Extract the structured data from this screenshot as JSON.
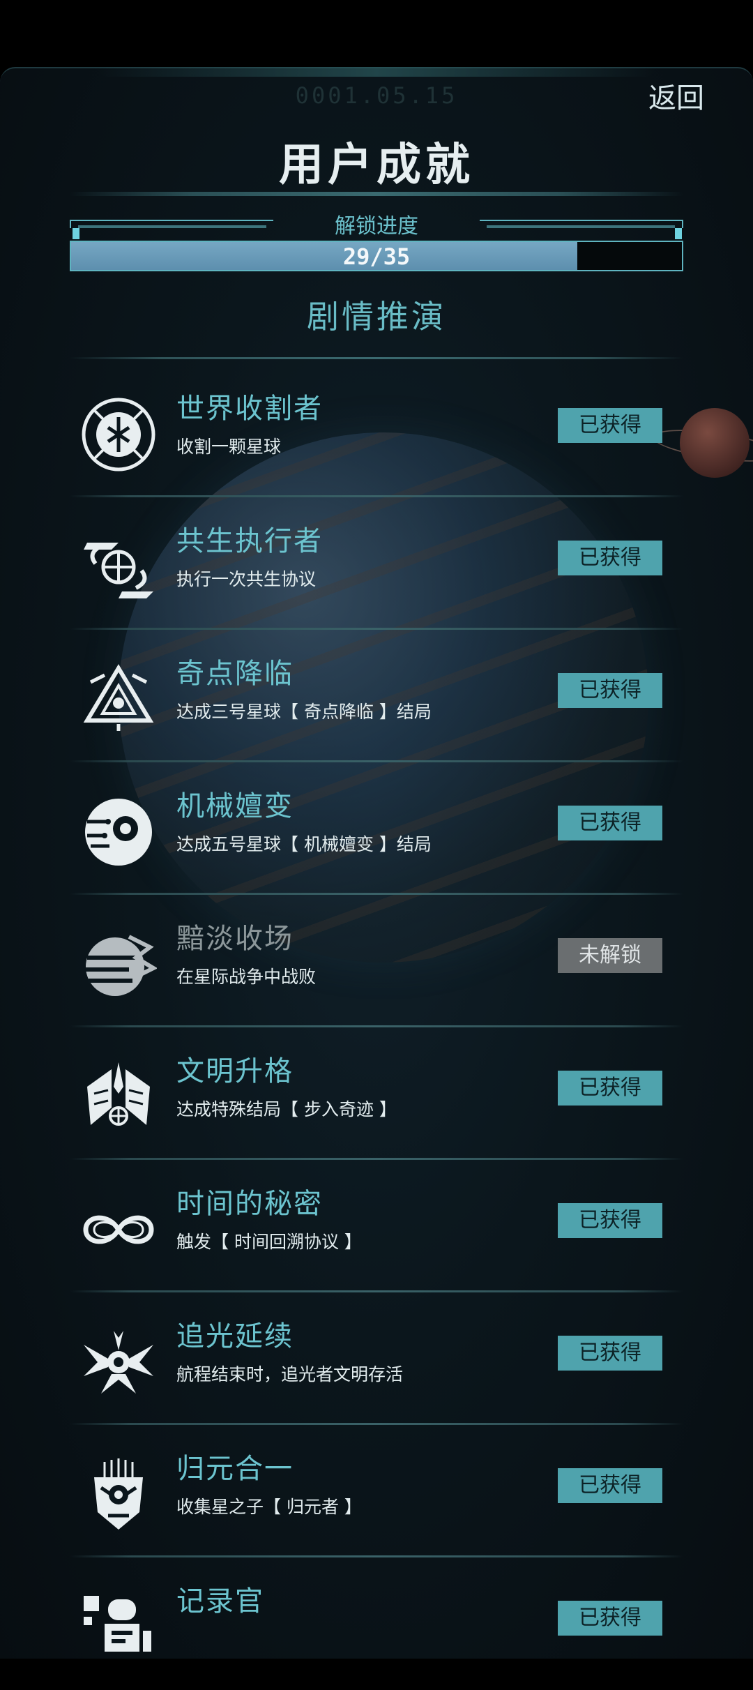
{
  "header": {
    "date": "0001.05.15",
    "back_label": "返回",
    "title": "用户成就"
  },
  "progress": {
    "label": "解锁进度",
    "text": "29/35",
    "unlocked": 29,
    "total": 35
  },
  "section_title": "剧情推演",
  "colors": {
    "accent": "#6cc4cf",
    "badge_obtained": "#4fa3ad",
    "badge_locked": "#6a6e70"
  },
  "achievements": [
    {
      "icon": "world-reaper-icon",
      "name": "世界收割者",
      "desc": "收割一颗星球",
      "status": "已获得",
      "unlocked": true
    },
    {
      "icon": "symbiosis-globe-hands-icon",
      "name": "共生执行者",
      "desc": "执行一次共生协议",
      "status": "已获得",
      "unlocked": true
    },
    {
      "icon": "singularity-triangle-icon",
      "name": "奇点降临",
      "desc": "达成三号星球【 奇点降临 】结局",
      "status": "已获得",
      "unlocked": true
    },
    {
      "icon": "mechanical-eye-icon",
      "name": "机械嬗变",
      "desc": "达成五号星球【 机械嬗变 】结局",
      "status": "已获得",
      "unlocked": true
    },
    {
      "icon": "broken-planet-icon",
      "name": "黯淡收场",
      "desc": "在星际战争中战败",
      "status": "未解锁",
      "unlocked": false
    },
    {
      "icon": "winged-emblem-icon",
      "name": "文明升格",
      "desc": "达成特殊结局【 步入奇迹 】",
      "status": "已获得",
      "unlocked": true
    },
    {
      "icon": "infinity-icon",
      "name": "时间的秘密",
      "desc": "触发【 时间回溯协议 】",
      "status": "已获得",
      "unlocked": true
    },
    {
      "icon": "light-chaser-wings-icon",
      "name": "追光延续",
      "desc": "航程结束时，追光者文明存活",
      "status": "已获得",
      "unlocked": true
    },
    {
      "icon": "robot-mask-icon",
      "name": "归元合一",
      "desc": "收集星之子【 归元者 】",
      "status": "已获得",
      "unlocked": true
    },
    {
      "icon": "recorder-icon",
      "name": "记录官",
      "desc": "",
      "status": "已获得",
      "unlocked": true
    }
  ]
}
